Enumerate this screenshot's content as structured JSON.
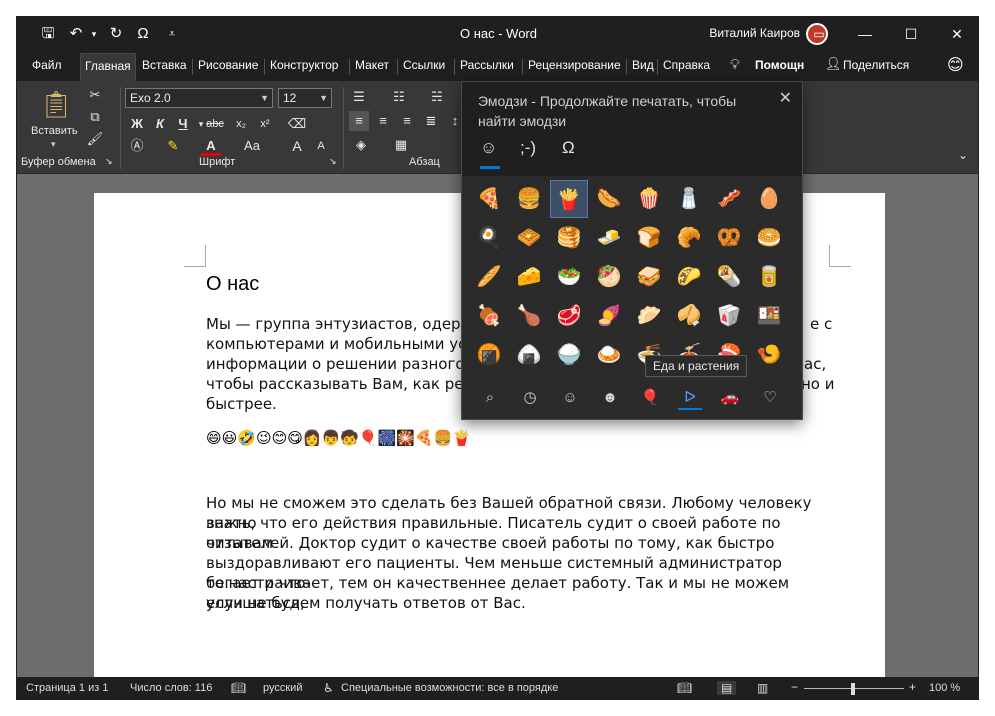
{
  "window": {
    "title": "О нас  -  Word",
    "user_name": "Виталий Каиров",
    "qat": {
      "save_icon": "save-icon",
      "undo_icon": "undo-icon",
      "redo_icon": "redo-icon",
      "symbol_label": "Ω",
      "customize_icon": "customize-icon"
    },
    "controls": {
      "ribbon_options": "▭",
      "minimize": "—",
      "maximize": "☐",
      "close": "✕"
    }
  },
  "tabs": [
    {
      "label": "Файл"
    },
    {
      "label": "Главная"
    },
    {
      "label": "Вставка"
    },
    {
      "label": "Рисование"
    },
    {
      "label": "Конструктор"
    },
    {
      "label": "Макет"
    },
    {
      "label": "Ссылки"
    },
    {
      "label": "Рассылки"
    },
    {
      "label": "Рецензирование"
    },
    {
      "label": "Вид"
    },
    {
      "label": "Справка"
    }
  ],
  "tabs_right": {
    "help_label": "Помощн",
    "share_label": "Поделиться",
    "emoji_icon": "😊"
  },
  "ribbon": {
    "clipboard": {
      "paste_label": "Вставить",
      "group_label": "Буфер обмена"
    },
    "font": {
      "font_name": "Exo 2.0",
      "font_size": "12",
      "group_label": "Шрифт",
      "bold": "Ж",
      "italic": "К",
      "underline": "Ч",
      "strike": "abc",
      "subscript": "x₂",
      "superscript": "x²",
      "case": "Aa",
      "grow": "A",
      "shrink": "A"
    },
    "paragraph": {
      "group_label": "Абзац"
    }
  },
  "document": {
    "heading": "О нас",
    "para1_line1": "Мы — группа энтузиастов, одержим",
    "para1_line1_tail": "е с",
    "para1_line2": "компьютерами и мобильными устр",
    "para1_line3": "информации о решении разного ро",
    "para1_line3_tail": "ас,",
    "para1_line4": "чтобы рассказывать Вам, как решат",
    "para1_line4_tail": "но и",
    "para1_line5": "быстрее.",
    "emoji_line": "😄😃🤣😉😊😋👩👦🧒🎈🎆🎇🍕🍔🍟",
    "para2": [
      "Но мы не сможем это сделать без Вашей обратной связи. Любому человеку важно",
      "знать, что его действия правильные. Писатель судит о своей работе по отзывам",
      "читателей. Доктор судит о качестве своей работы по тому, как быстро",
      "выздоравливают его пациенты. Чем меньше системный администратор бегает и что-",
      "то настраивает, тем он качественнее делает работу. Так и мы не можем улучшаться,",
      "если не будем получать ответов от Вас."
    ]
  },
  "statusbar": {
    "page": "Страница 1 из 1",
    "words": "Число слов: 116",
    "language": "русский",
    "accessibility": "Специальные возможности: все в порядке",
    "zoom": "100 %"
  },
  "emoji_panel": {
    "title": "Эмодзи - Продолжайте печатать, чтобы найти эмодзи",
    "tabs": [
      "☺",
      ";-)",
      "Ω"
    ],
    "emojis": [
      "🍕",
      "🍔",
      "🍟",
      "🌭",
      "🍿",
      "🧂",
      "🥓",
      "🥚",
      "🍳",
      "🧇",
      "🥞",
      "🧈",
      "🍞",
      "🥐",
      "🥨",
      "🥯",
      "🥖",
      "🧀",
      "🥗",
      "🥙",
      "🥪",
      "🌮",
      "🌯",
      "🥫",
      "🍖",
      "🍗",
      "🥩",
      "🍠",
      "🥟",
      "🥠",
      "🥡",
      "🍱",
      "🍘",
      "🍙",
      "🍚",
      "🍛",
      "🍜",
      "🍝",
      "🍣",
      "🍤"
    ],
    "categories": [
      "search",
      "recent",
      "smiley",
      "people",
      "celebration",
      "food",
      "transport",
      "heart"
    ],
    "category_glyphs": [
      "⌕",
      "◷",
      "☺",
      "☻",
      "🎈",
      "ᐅ",
      "🚗",
      "♡"
    ],
    "tooltip": "Еда и растения"
  }
}
